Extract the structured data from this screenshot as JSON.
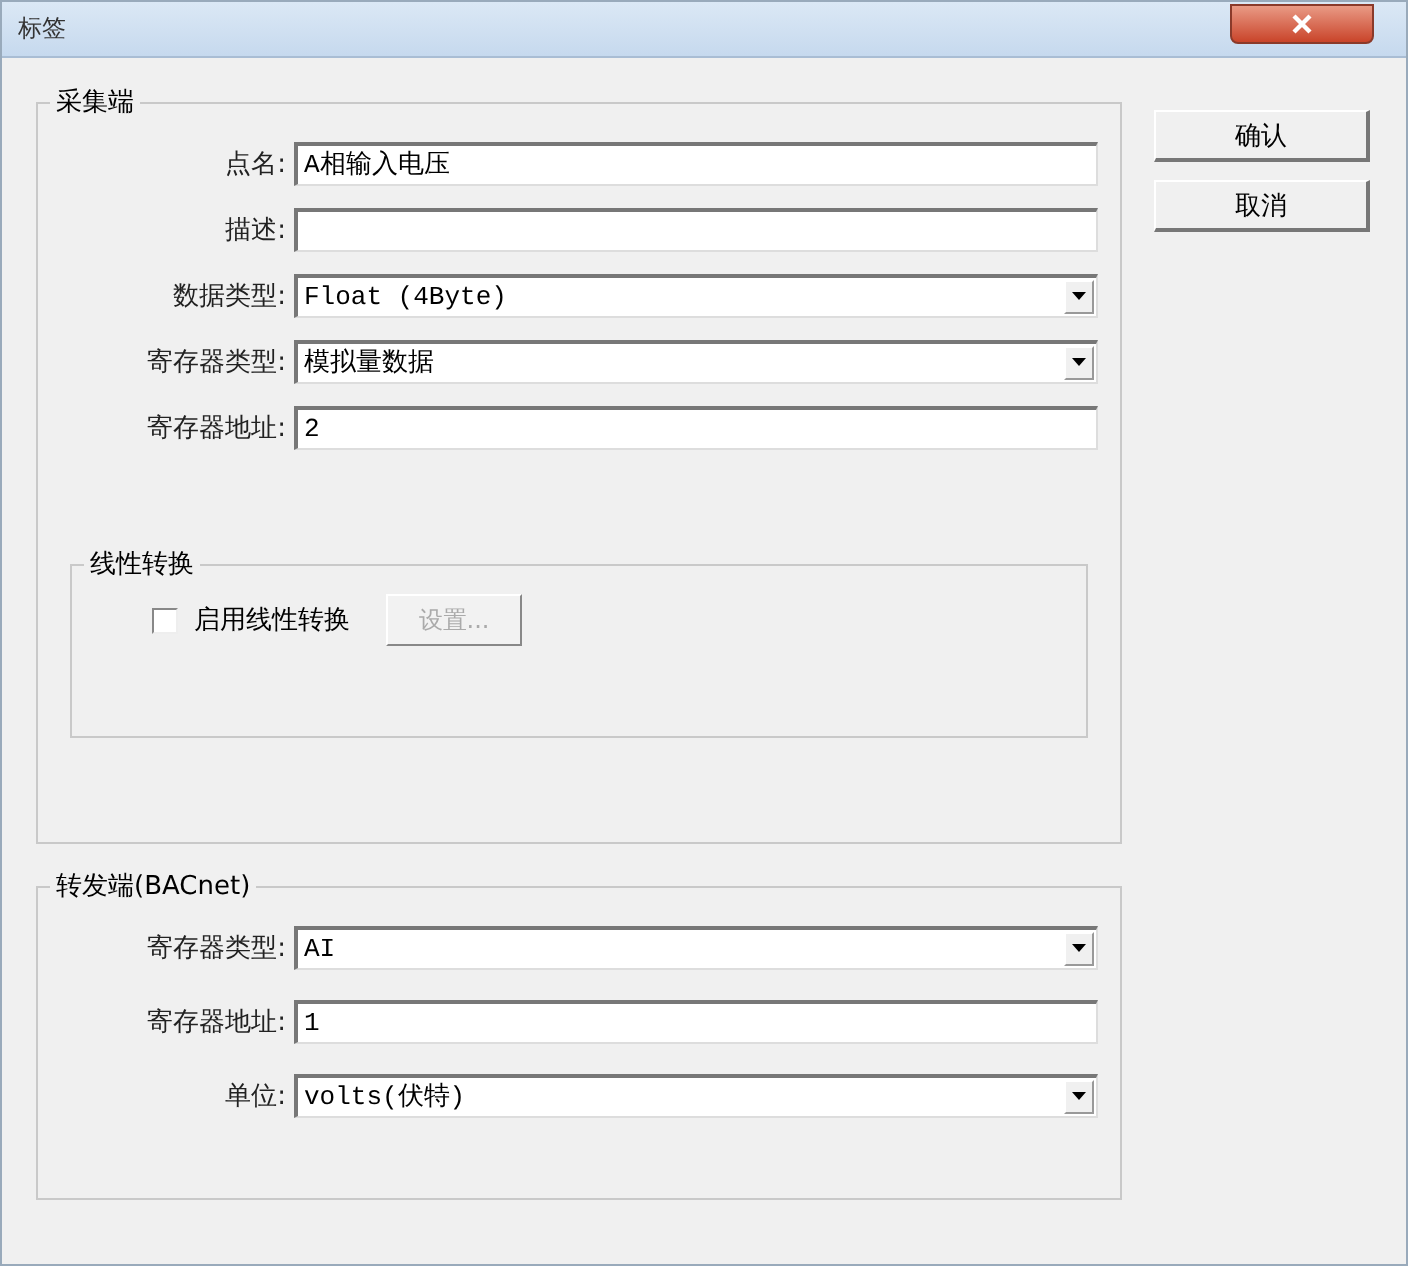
{
  "window": {
    "title": "标签"
  },
  "collector": {
    "title": "采集端",
    "fields": [
      {
        "label": "点名:",
        "kind": "text",
        "value": "A相输入电压"
      },
      {
        "label": "描述:",
        "kind": "text"
      },
      {
        "label": "数据类型:",
        "kind": "select",
        "value": "Float (4Byte)"
      },
      {
        "label": "寄存器类型:",
        "kind": "select",
        "value": "模拟量数据"
      },
      {
        "label": "寄存器地址:",
        "kind": "text",
        "value": "2"
      }
    ],
    "linear": {
      "title": "线性转换",
      "checkbox": {
        "label": "启用线性转换",
        "checked": false
      },
      "settings_button": {
        "label": "设置...",
        "disabled": true
      }
    }
  },
  "forwarder": {
    "title": "转发端(BACnet)",
    "fields": [
      {
        "label": "寄存器类型:",
        "kind": "select",
        "value": "AI"
      },
      {
        "label": "寄存器地址:",
        "kind": "text",
        "value": "1"
      },
      {
        "label": "单位:",
        "kind": "select",
        "value": "volts(伏特)"
      }
    ]
  },
  "buttons": [
    "确认",
    "取消"
  ]
}
